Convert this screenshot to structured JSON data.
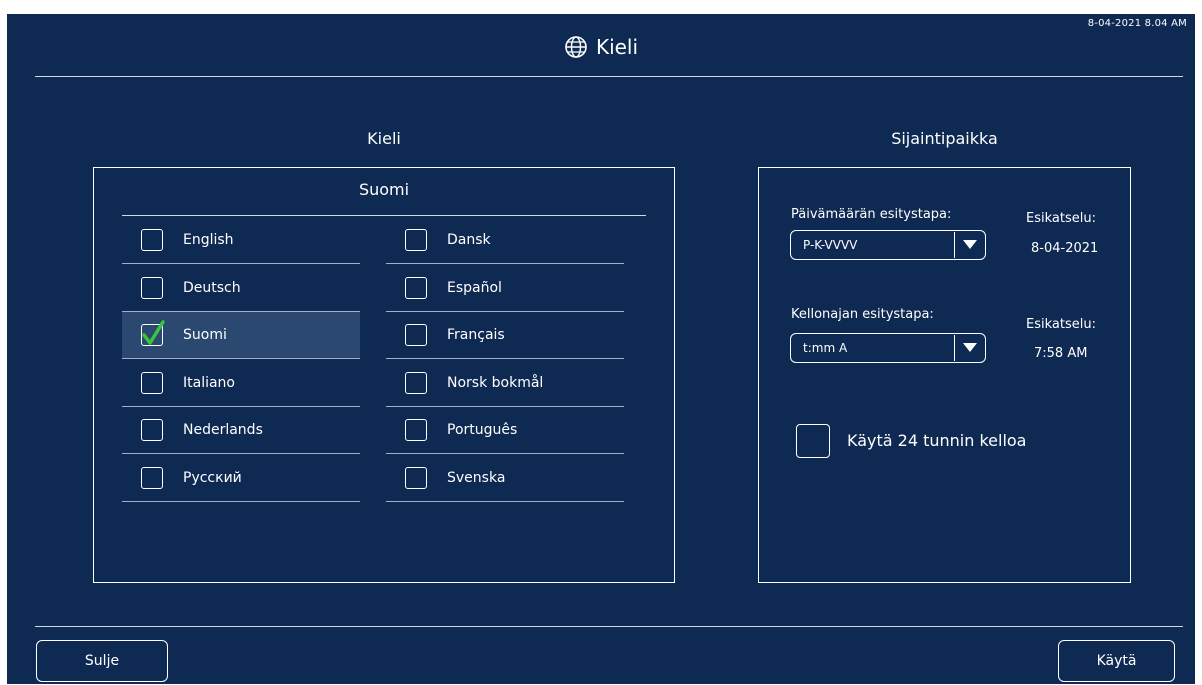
{
  "header": {
    "timestamp": "8-04-2021 8.04 AM",
    "title": "Kieli",
    "icon": "globe-icon"
  },
  "language_section": {
    "title": "Kieli",
    "current_language": "Suomi",
    "languages": [
      {
        "label": "English",
        "checked": false
      },
      {
        "label": "Deutsch",
        "checked": false
      },
      {
        "label": "Suomi",
        "checked": true
      },
      {
        "label": "Italiano",
        "checked": false
      },
      {
        "label": "Nederlands",
        "checked": false
      },
      {
        "label": "Русский",
        "checked": false
      },
      {
        "label": "Dansk",
        "checked": false
      },
      {
        "label": "Español",
        "checked": false
      },
      {
        "label": "Français",
        "checked": false
      },
      {
        "label": "Norsk bokmål",
        "checked": false
      },
      {
        "label": "Português",
        "checked": false
      },
      {
        "label": "Svenska",
        "checked": false
      }
    ]
  },
  "location_section": {
    "title": "Sijaintipaikka",
    "date_format_label": "Päivämäärän esitystapa:",
    "date_format_value": "P-K-VVVV",
    "date_preview_label": "Esikatselu:",
    "date_preview_value": "8-04-2021",
    "time_format_label": "Kellonajan esitystapa:",
    "time_format_value": "t:mm A",
    "time_preview_label": "Esikatselu:",
    "time_preview_value": "7:58 AM",
    "use_24h_label": "Käytä 24 tunnin kelloa",
    "use_24h_checked": false
  },
  "footer": {
    "close_label": "Sulje",
    "apply_label": "Käytä"
  },
  "colors": {
    "background": "#0e2a52",
    "selected_row": "#2a4870",
    "check_green": "#3cc43c"
  }
}
